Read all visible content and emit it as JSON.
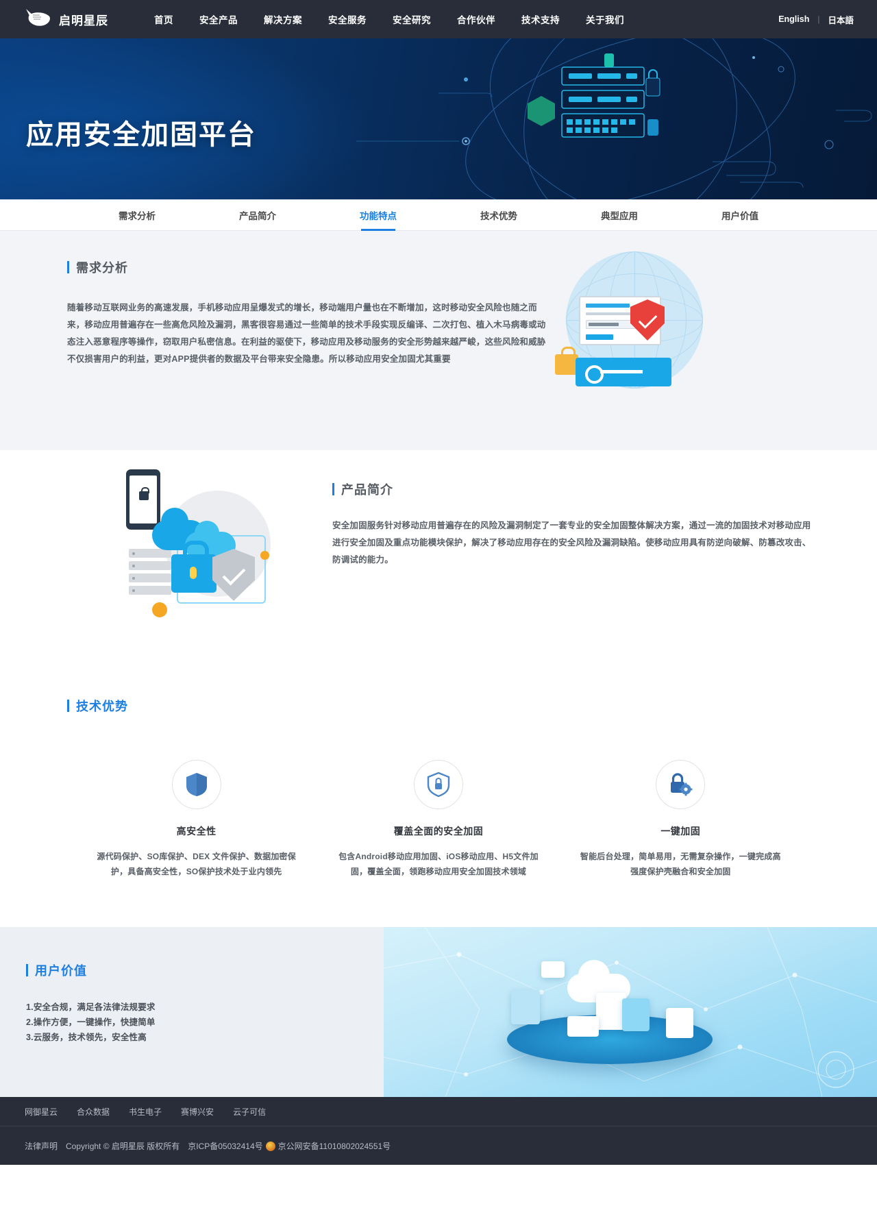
{
  "topnav": {
    "brand": "启明星辰",
    "brand_icon": "bird-logo",
    "links": [
      {
        "label": "首页",
        "name": "nav-home"
      },
      {
        "label": "安全产品",
        "name": "nav-security-products"
      },
      {
        "label": "解决方案",
        "name": "nav-solutions"
      },
      {
        "label": "安全服务",
        "name": "nav-security-services"
      },
      {
        "label": "安全研究",
        "name": "nav-security-research"
      },
      {
        "label": "合作伙伴",
        "name": "nav-partners"
      },
      {
        "label": "技术支持",
        "name": "nav-support"
      },
      {
        "label": "关于我们",
        "name": "nav-about-us"
      }
    ],
    "lang_en": "English",
    "lang_sep": "|",
    "lang_jp": "日本語"
  },
  "hero": {
    "title": "应用安全加固平台"
  },
  "section_tabs": [
    {
      "label": "需求分析",
      "active": false
    },
    {
      "label": "产品简介",
      "active": false
    },
    {
      "label": "功能特点",
      "active": true
    },
    {
      "label": "技术优势",
      "active": false
    },
    {
      "label": "典型应用",
      "active": false
    },
    {
      "label": "用户价值",
      "active": false
    }
  ],
  "demand": {
    "heading": "需求分析",
    "paragraph": "随着移动互联网业务的高速发展，手机移动应用呈爆发式的增长，移动端用户量也在不断增加，这时移动安全风险也随之而来，移动应用普遍存在一些高危风险及漏洞，黑客很容易通过一些简单的技术手段实现反编译、二次打包、植入木马病毒或动态注入恶意程序等操作，窃取用户私密信息。在利益的驱使下，移动应用及移动服务的安全形势越来越严峻，这些风险和威胁不仅损害用户的利益，更对APP提供者的数据及平台带来安全隐患。所以移动应用安全加固尤其重要",
    "illustration": "globe-shield-key-illustration"
  },
  "intro": {
    "heading": "产品简介",
    "paragraph": "安全加固服务针对移动应用普遍存在的风险及漏洞制定了一套专业的安全加固整体解决方案，通过一流的加固技术对移动应用进行安全加固及重点功能模块保护，解决了移动应用存在的安全风险及漏洞缺陷。使移动应用具有防逆向破解、防篡改攻击、防调试的能力。",
    "illustration": "phone-cloud-lock-shield-illustration"
  },
  "tech": {
    "heading": "技术优势",
    "cards": [
      {
        "icon": "shield-icon",
        "title": "高安全性",
        "desc": "源代码保护、SO库保护、DEX 文件保护、数据加密保护，具备高安全性，SO保护技术处于业内领先"
      },
      {
        "icon": "shield-lock-icon",
        "title": "覆盖全面的安全加固",
        "desc": "包含Android移动应用加固、iOS移动应用、H5文件加固，覆盖全面，领跑移动应用安全加固技术领域"
      },
      {
        "icon": "lock-gear-icon",
        "title": "一键加固",
        "desc": "智能后台处理，简单易用，无需复杂操作，一键完成高强度保护壳融合和安全加固"
      }
    ]
  },
  "value": {
    "heading": "用户价值",
    "items": [
      "1.安全合规，满足各法律法规要求",
      "2.操作方便，一键操作，快捷简单",
      "3.云服务，技术领先，安全性高"
    ],
    "illustration": "cloud-platform-illustration"
  },
  "footer": {
    "links": [
      {
        "label": "网御星云"
      },
      {
        "label": "合众数据"
      },
      {
        "label": "书生电子"
      },
      {
        "label": "赛博兴安"
      },
      {
        "label": "云子可信"
      }
    ],
    "legal": "法律声明",
    "copyright": "Copyright © 启明星辰 版权所有",
    "icp": "京ICP备05032414号",
    "police": "京公网安备11010802024551号"
  },
  "colors": {
    "nav_bg": "#282d39",
    "accent_blue": "#1d7fe0",
    "hero_blue_dark": "#061a38",
    "hero_blue_light": "#0a3d7d",
    "section_gray": "#f2f4f7",
    "value_gray": "#eceff3"
  }
}
